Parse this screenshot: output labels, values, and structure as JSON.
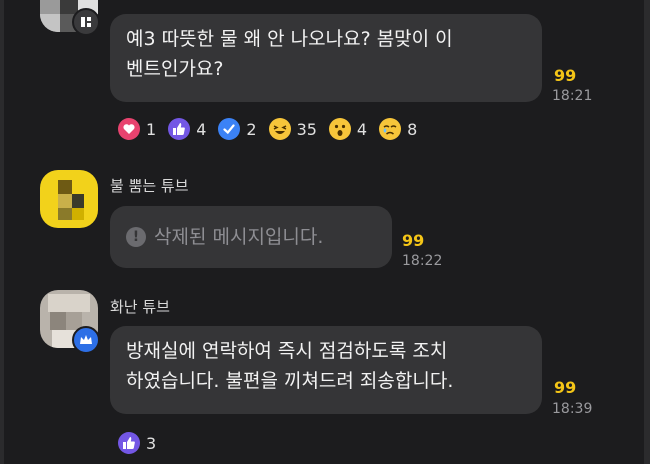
{
  "messages": [
    {
      "text_line1": "예3 따뜻한 물 왜 안 나오나요? 봄맞이 이",
      "text_line2": "벤트인가요?",
      "unread": "99",
      "time": "18:21",
      "reactions": [
        {
          "icon": "heart-icon",
          "count": "1",
          "color": "#e8436f"
        },
        {
          "icon": "thumbs-up-icon",
          "count": "4",
          "color": "#7357e5"
        },
        {
          "icon": "check-icon",
          "count": "2",
          "color": "#3b82f6"
        },
        {
          "icon": "laughing-emoji-icon",
          "count": "35",
          "color": "#f7c53a"
        },
        {
          "icon": "surprised-emoji-icon",
          "count": "4",
          "color": "#f7c53a"
        },
        {
          "icon": "crying-emoji-icon",
          "count": "8",
          "color": "#f7c53a"
        }
      ]
    },
    {
      "sender": "불 뿜는 튜브",
      "deleted_text": "삭제된 메시지입니다.",
      "unread": "99",
      "time": "18:22"
    },
    {
      "sender": "화난 튜브",
      "text_line1": "방재실에 연락하여 즉시 점검하도록 조치",
      "text_line2": "하였습니다. 불편을 끼쳐드려 죄송합니다.",
      "unread": "99",
      "time": "18:39",
      "reactions": [
        {
          "icon": "thumbs-up-icon",
          "count": "3",
          "color": "#7357e5"
        }
      ]
    }
  ],
  "colors": {
    "unread": "#f4c517",
    "bubble": "#353537",
    "background": "#1c1c1e"
  }
}
